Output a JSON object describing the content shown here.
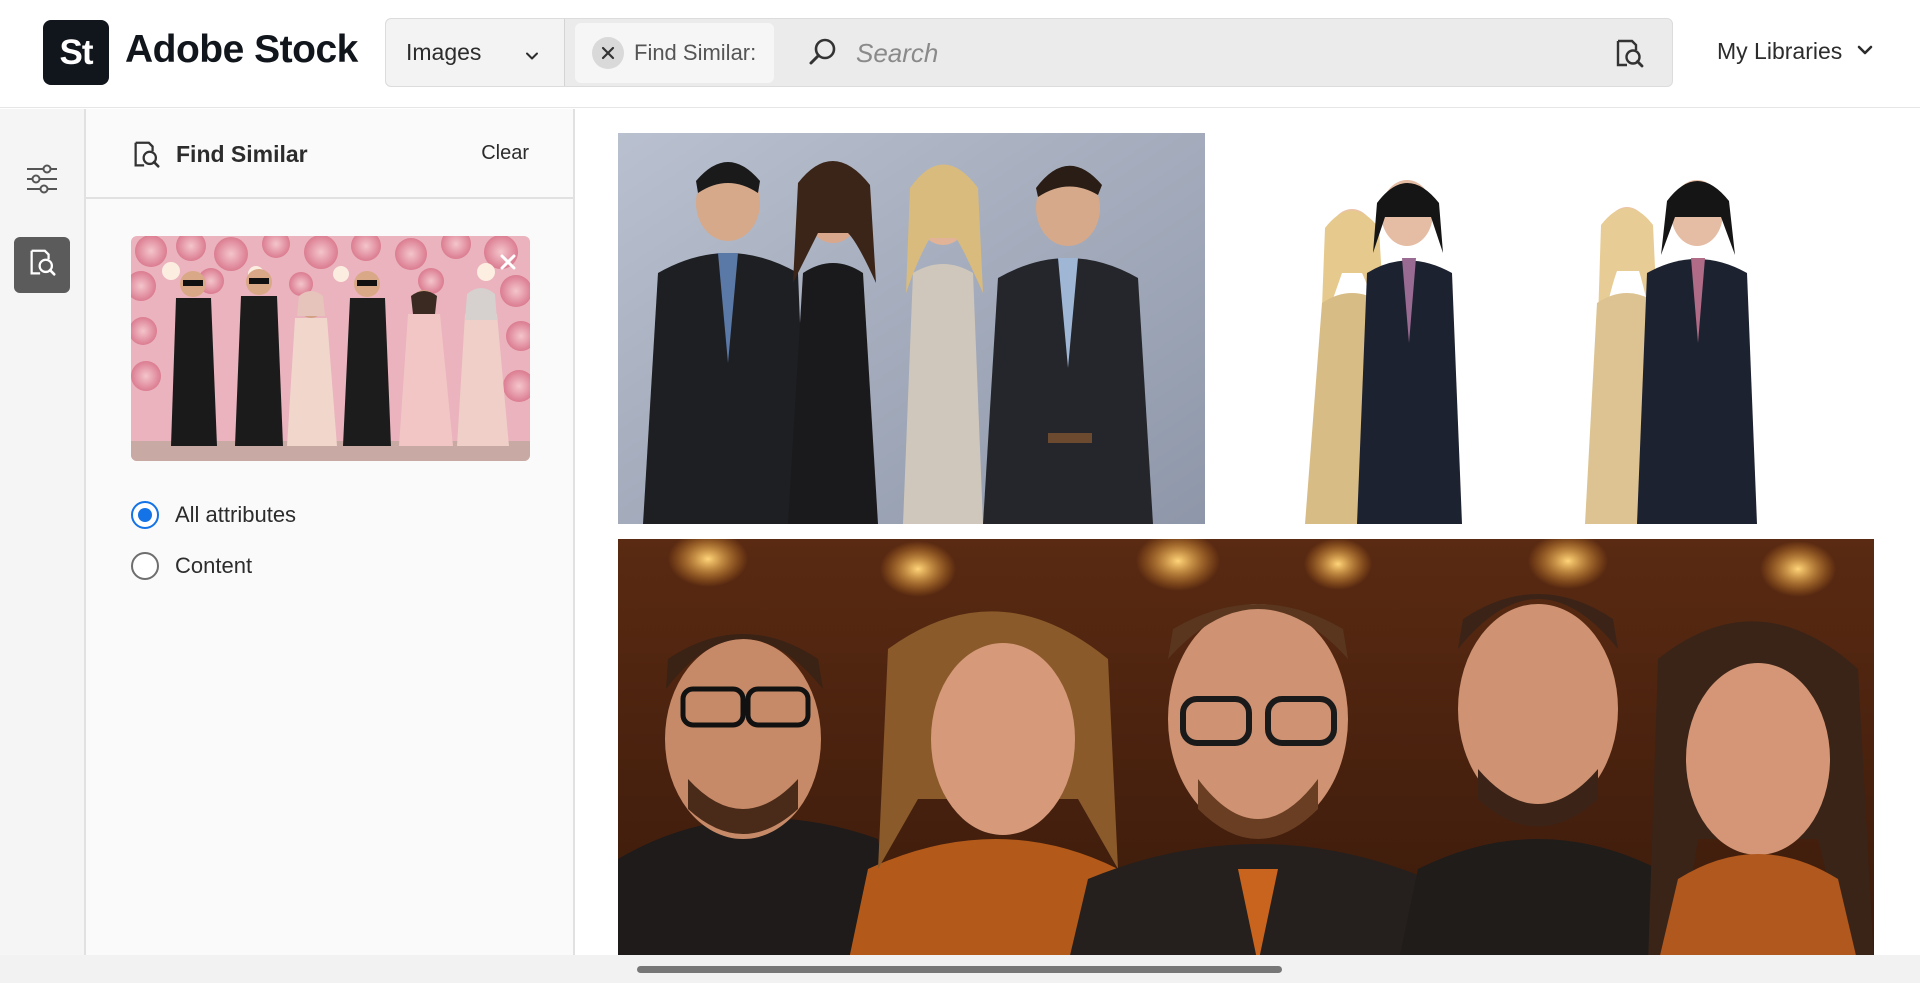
{
  "brand": {
    "badge": "St",
    "name": "Adobe Stock"
  },
  "search": {
    "type_value": "Images",
    "chip_label": "Find Similar:",
    "placeholder": "Search"
  },
  "header": {
    "libraries_label": "My Libraries"
  },
  "panel": {
    "title": "Find Similar",
    "clear_label": "Clear",
    "options": [
      {
        "label": "All attributes",
        "checked": true
      },
      {
        "label": "Content",
        "checked": false
      }
    ]
  },
  "icons": {
    "type_chevron": "chevron-down-icon",
    "chip_close": "close-icon",
    "search": "search-icon",
    "visual_search": "visual-search-icon",
    "libraries_chevron": "chevron-down-icon",
    "filters": "filters-icon",
    "find_similar": "find-similar-icon",
    "remove_reference": "close-icon"
  },
  "colors": {
    "accent": "#1473e6",
    "brand_dark": "#11151c"
  }
}
